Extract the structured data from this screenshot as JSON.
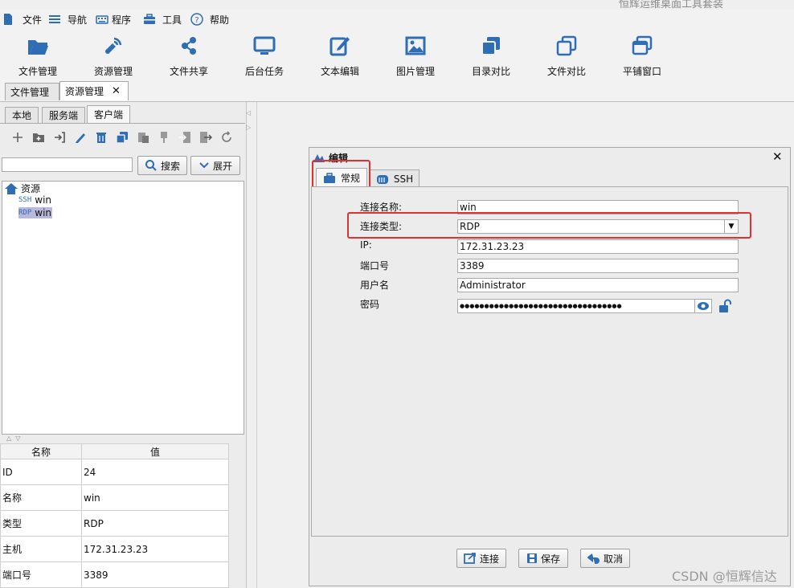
{
  "window_title": "恒辉运维桌面工具套装",
  "menus": [
    {
      "label": "文件",
      "icon": "file-icon"
    },
    {
      "label": "导航",
      "icon": "list-icon"
    },
    {
      "label": "程序",
      "icon": "keyboard-icon"
    },
    {
      "label": "工具",
      "icon": "toolbox-icon"
    },
    {
      "label": "帮助",
      "icon": "help-icon"
    }
  ],
  "toolbar": [
    "文件管理",
    "资源管理",
    "文件共享",
    "后台任务",
    "文本编辑",
    "图片管理",
    "目录对比",
    "文件对比",
    "平铺窗口"
  ],
  "doc_tabs": [
    "文件管理",
    "资源管理"
  ],
  "left_tabs": [
    "本地",
    "服务端",
    "客户端"
  ],
  "search_btn": "搜索",
  "expand_btn": "展开",
  "tree": {
    "root": "资源",
    "items": [
      {
        "type": "SSH",
        "name": "win"
      },
      {
        "type": "RDP",
        "name": "win"
      }
    ]
  },
  "props_header": {
    "name": "名称",
    "value": "值"
  },
  "props": [
    {
      "name": "ID",
      "value": "24"
    },
    {
      "name": "名称",
      "value": "win"
    },
    {
      "name": "类型",
      "value": "RDP"
    },
    {
      "name": "主机",
      "value": "172.31.23.23"
    },
    {
      "name": "端口号",
      "value": "3389"
    }
  ],
  "dialog": {
    "title": "编辑",
    "tabs": [
      "常规",
      "SSH"
    ],
    "labels": {
      "name": "连接名称:",
      "type": "连接类型:",
      "ip": "IP:",
      "port": "端口号",
      "user": "用户名",
      "pwd": "密码"
    },
    "values": {
      "name": "win",
      "type": "RDP",
      "ip": "172.31.23.23",
      "port": "3389",
      "user": "Administrator",
      "pwd": "●●●●●●●●●●●●●●●●●●●●●●●●●●●●●●●●●"
    },
    "buttons": {
      "connect": "连接",
      "save": "保存",
      "cancel": "取消"
    }
  },
  "watermark": "CSDN @恒辉信达",
  "colors": {
    "accent": "#2f6db5",
    "highlight": "#e23131"
  }
}
